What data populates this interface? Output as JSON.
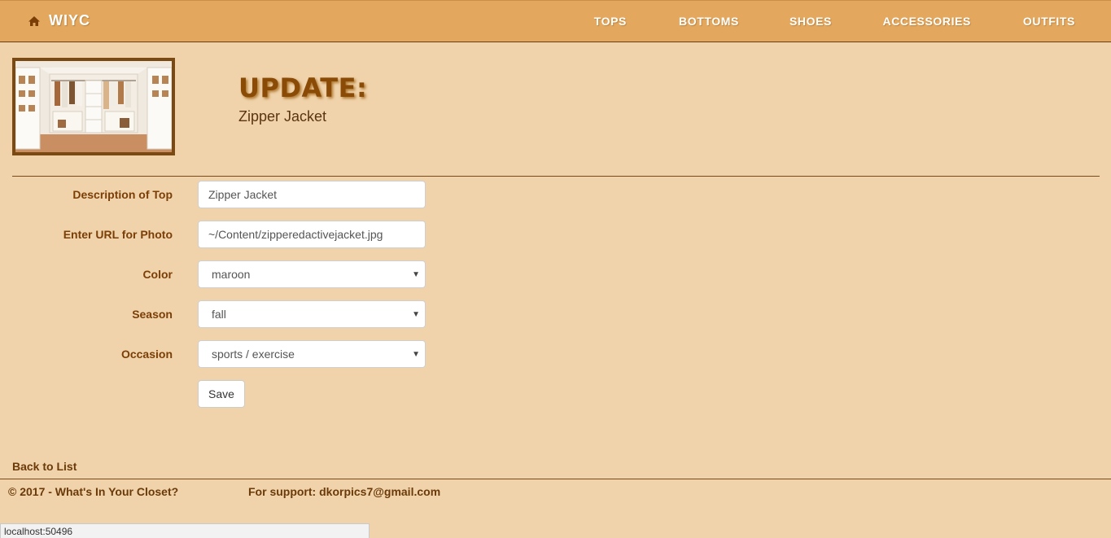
{
  "nav": {
    "brand": "WIYC",
    "items": [
      "TOPS",
      "BOTTOMS",
      "SHOES",
      "ACCESSORIES",
      "OUTFITS"
    ]
  },
  "header": {
    "title": "UPDATE:",
    "subtitle": "Zipper Jacket"
  },
  "form": {
    "description_label": "Description of Top",
    "description_value": "Zipper Jacket",
    "photo_label": "Enter URL for Photo",
    "photo_value": "~/Content/zipperedactivejacket.jpg",
    "color_label": "Color",
    "color_value": "maroon",
    "season_label": "Season",
    "season_value": "fall",
    "occasion_label": "Occasion",
    "occasion_value": "sports / exercise",
    "save_label": "Save"
  },
  "footer": {
    "back_link": "Back to List",
    "copyright": "© 2017 - What's In Your Closet?",
    "support_label": "For support:",
    "support_email": "dkorpics7@gmail.com"
  },
  "statusbar": {
    "url": "localhost:50496"
  },
  "icons": {
    "home": "home-icon",
    "closet": "closet-image",
    "select_caret": "caret-down-icon"
  },
  "colors": {
    "background": "#f0d3ab",
    "navbar": "#e3a85e",
    "text_brown": "#6b3a09",
    "title": "#8a4b07"
  }
}
